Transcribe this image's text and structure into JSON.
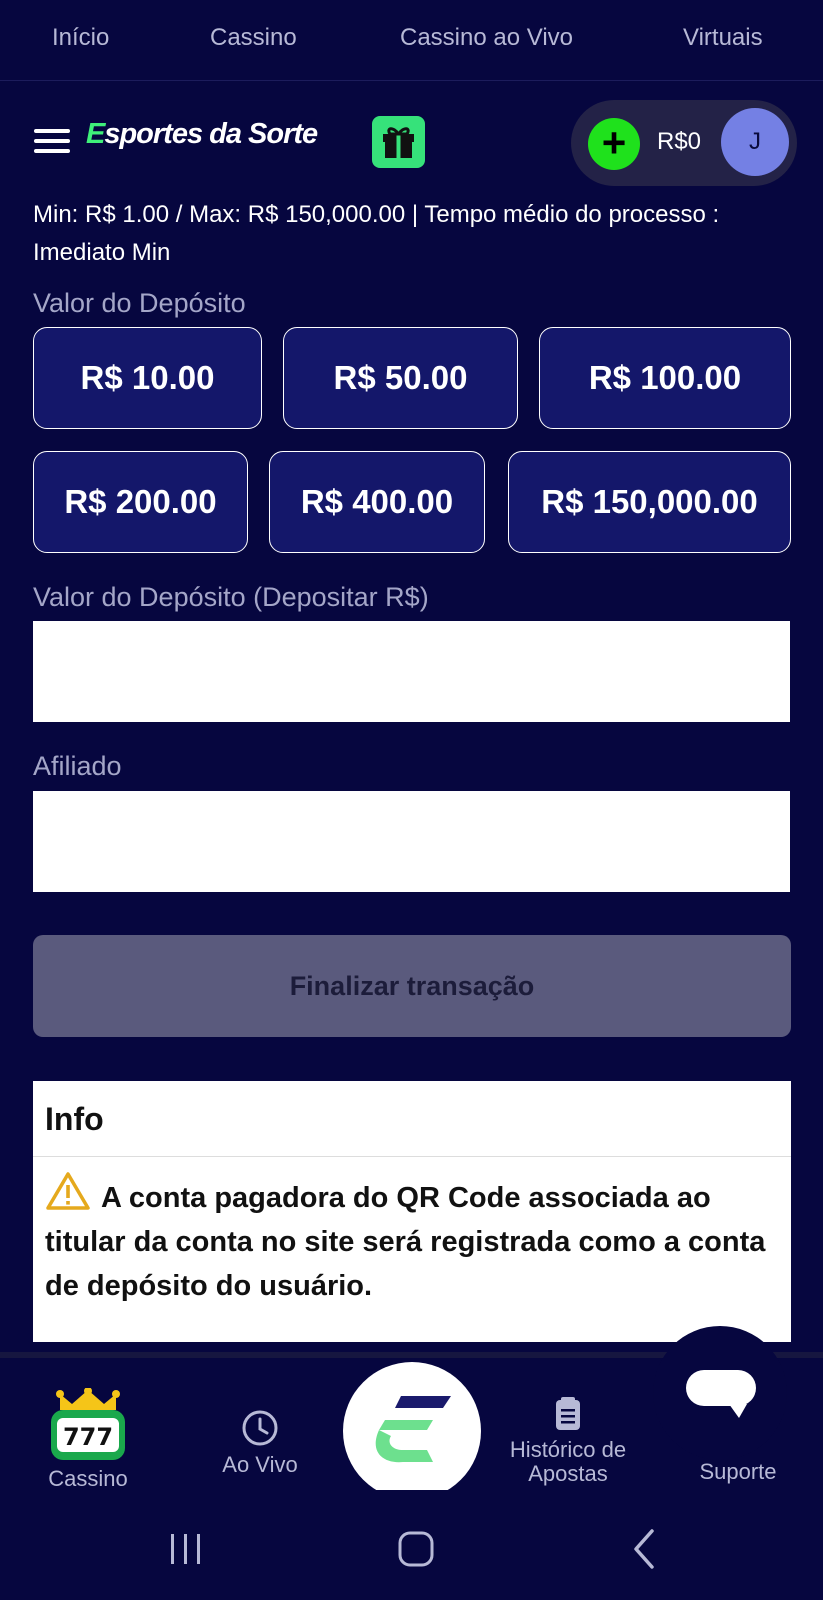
{
  "top_nav": [
    "Início",
    "Cassino",
    "Cassino ao Vivo",
    "Virtuais"
  ],
  "header": {
    "logo": "Esportes da Sorte",
    "balance": "R$0",
    "avatar_initial": "J"
  },
  "deposit": {
    "limits_text": "Min: R$ 1.00 / Max: R$ 150,000.00 | Tempo médio do processo : Imediato Min",
    "amount_label": "Valor do Depósito",
    "quick_amounts_row1": [
      "R$ 10.00",
      "R$ 50.00",
      "R$ 100.00"
    ],
    "quick_amounts_row2": [
      "R$ 200.00",
      "R$ 400.00",
      "R$ 150,000.00"
    ],
    "input_label": "Valor do Depósito (Depositar R$)",
    "input_value": "",
    "affiliate_label": "Afiliado",
    "affiliate_value": "",
    "submit_label": "Finalizar transação"
  },
  "info": {
    "title": "Info",
    "text": "A conta pagadora do QR Code associada ao titular da conta no site será registrada como a conta de depósito do usuário."
  },
  "bottom_nav": {
    "casino": "Cassino",
    "live": "Ao Vivo",
    "history": "Histórico de Apostas",
    "support": "Suporte"
  },
  "colors": {
    "background": "#06063f",
    "amount_button": "#14176a",
    "accent_green": "#1fe11c",
    "avatar": "#7480e4",
    "submit_disabled": "#5a5a7d"
  }
}
